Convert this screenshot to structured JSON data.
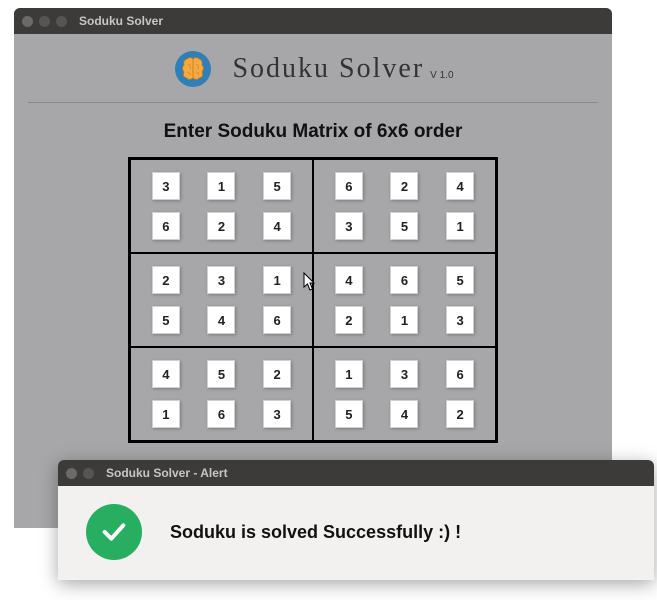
{
  "main_window": {
    "title": "Soduku Solver"
  },
  "header": {
    "app_title": "Soduku  Solver",
    "version": "V 1.0"
  },
  "instruction": "Enter Soduku Matrix of 6x6 order",
  "grid": {
    "rows": [
      [
        "3",
        "1",
        "5",
        "6",
        "2",
        "4"
      ],
      [
        "6",
        "2",
        "4",
        "3",
        "5",
        "1"
      ],
      [
        "2",
        "3",
        "1",
        "4",
        "6",
        "5"
      ],
      [
        "5",
        "4",
        "6",
        "2",
        "1",
        "3"
      ],
      [
        "4",
        "5",
        "2",
        "1",
        "3",
        "6"
      ],
      [
        "1",
        "6",
        "3",
        "5",
        "4",
        "2"
      ]
    ]
  },
  "alert": {
    "title": "Soduku Solver - Alert",
    "message": "Soduku is solved Successfully :) !"
  }
}
